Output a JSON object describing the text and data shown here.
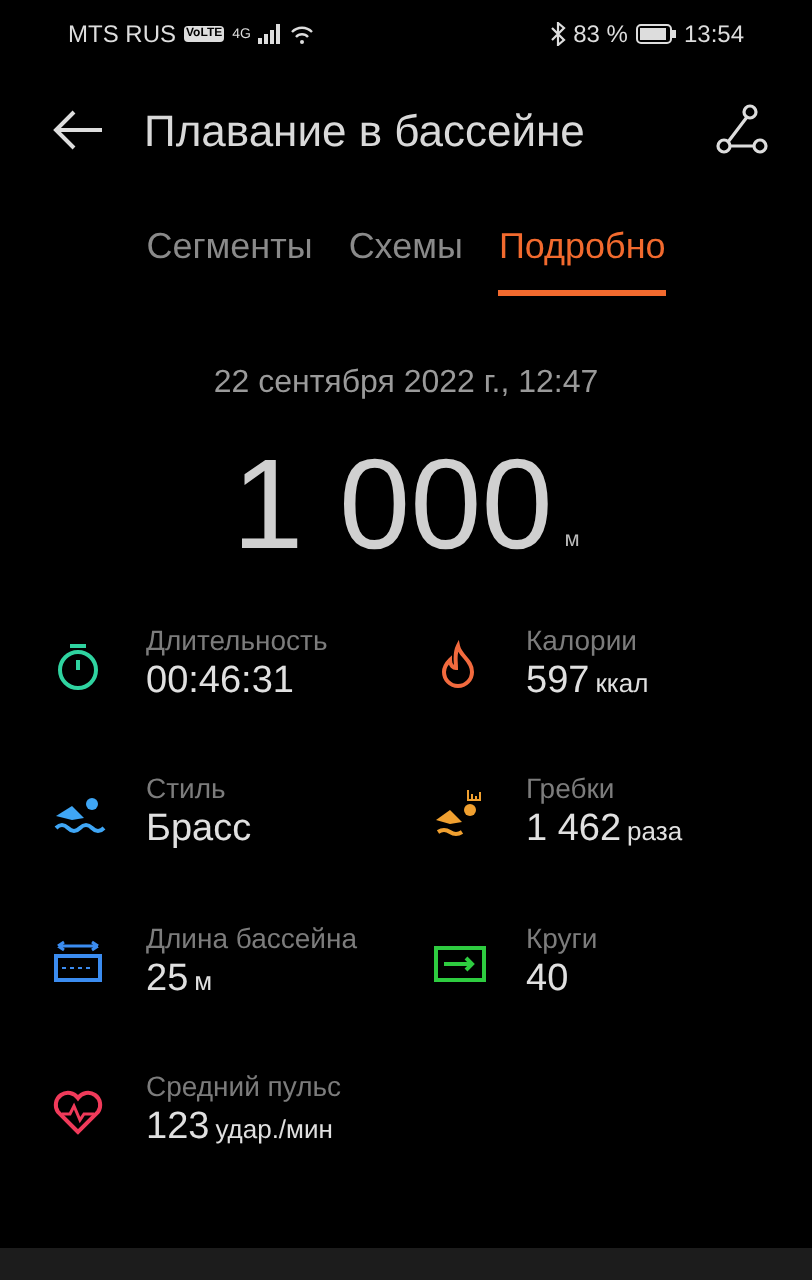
{
  "status_bar": {
    "carrier": "MTS RUS",
    "volte": "VoLTE",
    "network": "4G",
    "battery": "83 %",
    "time": "13:54"
  },
  "header": {
    "title": "Плавание в бассейне"
  },
  "tabs": [
    {
      "label": "Сегменты",
      "selected": false
    },
    {
      "label": "Схемы",
      "selected": false
    },
    {
      "label": "Подробно",
      "selected": true
    }
  ],
  "summary": {
    "date": "22 сентября 2022 г., 12:47",
    "distance": "1 000",
    "unit": "м"
  },
  "metrics": [
    {
      "kind": "duration",
      "label": "Длительность",
      "value": "00:46:31"
    },
    {
      "kind": "calories",
      "label": "Калории",
      "value": "597",
      "unit": "ккал"
    },
    {
      "kind": "style",
      "label": "Стиль",
      "value": "Брасс"
    },
    {
      "kind": "strokes",
      "label": "Гребки",
      "value": "1 462",
      "unit": "раза"
    },
    {
      "kind": "pool",
      "label": "Длина бассейна",
      "value": "25",
      "unit": "м"
    },
    {
      "kind": "laps",
      "label": "Круги",
      "value": "40"
    },
    {
      "kind": "heart",
      "label": "Средний пульс",
      "value": "123",
      "unit": "удар./мин"
    }
  ]
}
